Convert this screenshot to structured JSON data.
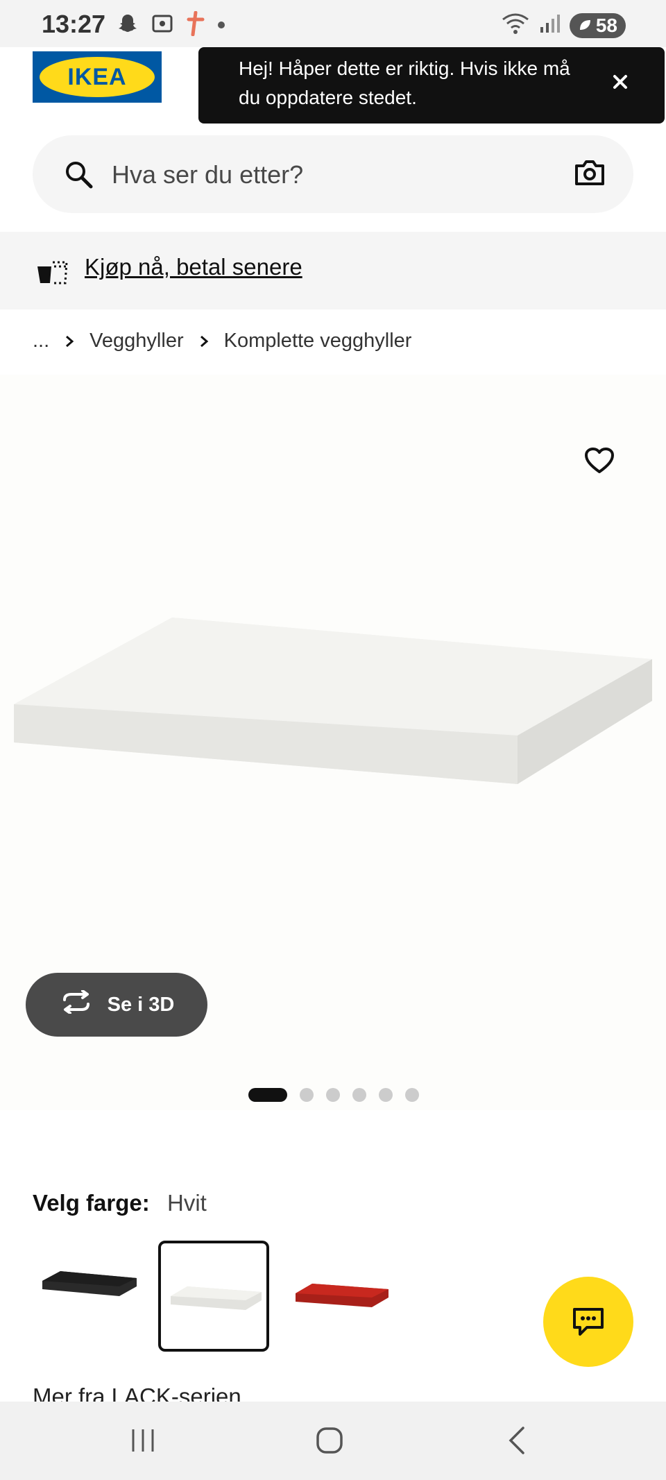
{
  "status_bar": {
    "time": "13:27",
    "battery": "58"
  },
  "brand": {
    "logo_text": "IKEA"
  },
  "toast": {
    "message": "Hej! Håper dette er riktig. Hvis ikke må du oppdatere stedet."
  },
  "search": {
    "placeholder": "Hva ser du etter?"
  },
  "promo": {
    "link_text": "Kjøp nå, betal senere"
  },
  "breadcrumb": {
    "items": [
      "...",
      "Vegghyller",
      "Komplette vegghyller"
    ]
  },
  "gallery": {
    "button_3d": "Se i 3D",
    "total_images": 6,
    "active_index": 0
  },
  "color_selector": {
    "label": "Velg farge:",
    "selected": "Hvit",
    "options": [
      {
        "name": "black",
        "color": "#1e1e1e"
      },
      {
        "name": "white",
        "color": "#f2f2ee"
      },
      {
        "name": "red",
        "color": "#c8281f"
      }
    ]
  },
  "more_series": "Mer fra LACK-serien",
  "colors": {
    "ikea_blue": "#0058a3",
    "ikea_yellow": "#ffda1a",
    "toast_bg": "#111111"
  }
}
